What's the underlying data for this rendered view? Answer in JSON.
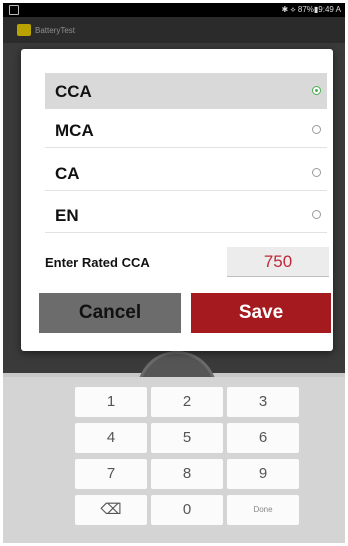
{
  "status_bar": {
    "right_text": "✱ ⟡ 87%▮9:49 A"
  },
  "app_header": {
    "name": "BatteryTest"
  },
  "dialog": {
    "options": [
      {
        "label": "CCA",
        "selected": true
      },
      {
        "label": "MCA",
        "selected": false
      },
      {
        "label": "CA",
        "selected": false
      },
      {
        "label": "EN",
        "selected": false
      }
    ],
    "rated_label": "Enter Rated CCA",
    "rated_value": "750",
    "cancel_label": "Cancel",
    "save_label": "Save"
  },
  "keyboard": {
    "keys": [
      "1",
      "2",
      "3",
      "4",
      "5",
      "6",
      "7",
      "8",
      "9",
      "⌫",
      "0",
      "Done"
    ]
  },
  "colors": {
    "save_button": "#a51a1f",
    "cancel_button": "#6c6c6c",
    "rated_value": "#c0273a",
    "radio_selected": "#4caf50"
  }
}
